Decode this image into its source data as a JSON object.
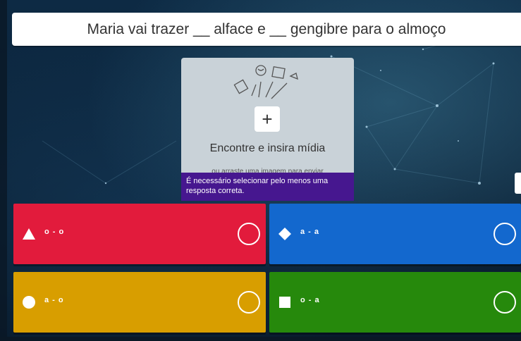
{
  "question": {
    "text": "Maria vai trazer __ alface e __ gengibre para o almoço"
  },
  "media": {
    "title": "Encontre e insira mídia",
    "subtitle": "ou arraste uma imagem para enviar",
    "add_icon": "plus-icon"
  },
  "tooltip": {
    "text": "É necessário selecionar pelo menos uma resposta correta."
  },
  "answers": [
    {
      "shape": "triangle",
      "label": "o - o",
      "color": "#e21b3c",
      "checked": false
    },
    {
      "shape": "diamond",
      "label": "a - a",
      "color": "#1368ce",
      "checked": false
    },
    {
      "shape": "circle",
      "label": "a - o",
      "color": "#d89e00",
      "checked": false
    },
    {
      "shape": "square",
      "label": "o - a",
      "color": "#26890c",
      "checked": false
    }
  ]
}
